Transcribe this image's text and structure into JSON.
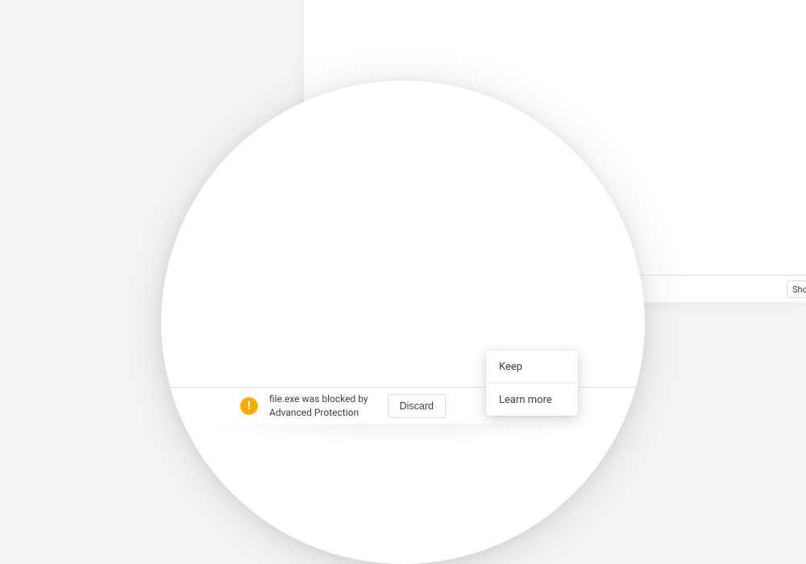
{
  "download": {
    "blocked_line1": "file.exe was blocked by",
    "blocked_line2": "Advanced Protection",
    "discard_label": "Discard"
  },
  "menu": {
    "keep_label": "Keep",
    "learn_more_label": "Learn more"
  },
  "toolbar": {
    "show_all_label": "Show"
  }
}
